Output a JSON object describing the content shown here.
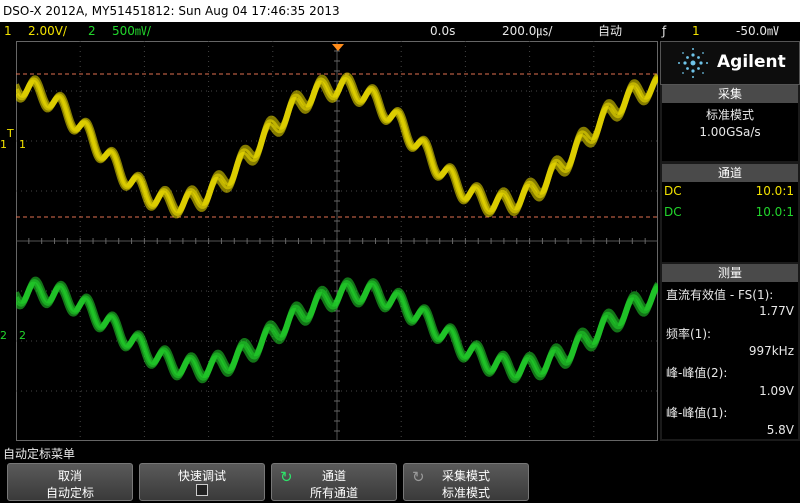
{
  "title_bar": "DSO-X 2012A, MY51451812: Sun Aug 04 17:46:35 2013",
  "status": {
    "ch1_num": "1",
    "ch1_scale": "2.00V/",
    "ch2_num": "2",
    "ch2_scale": "500㎷/",
    "time_delay": "0.0s",
    "time_scale": "200.0㎲/",
    "trigger_mode": "自动",
    "trigger_icon": "ƒ",
    "trigger_source": "1",
    "trigger_level": "-50.0㎷"
  },
  "markers": {
    "trig_letter": "T",
    "ch1_left": "1",
    "ch1_right": "1",
    "ch2_left": "2",
    "ch2_right": "2"
  },
  "panel": {
    "brand": "Agilent",
    "acquire": {
      "header": "采集",
      "mode": "标准模式",
      "rate": "1.00GSa/s"
    },
    "channels": {
      "header": "通道",
      "rows": [
        {
          "coupling": "DC",
          "probe": "10.0:1",
          "color": "#f2e200"
        },
        {
          "coupling": "DC",
          "probe": "10.0:1",
          "color": "#22d62c"
        }
      ]
    },
    "measure": {
      "header": "测量",
      "items": [
        {
          "label": "直流有效值 - FS(1):",
          "value": "1.77V"
        },
        {
          "label": "频率(1):",
          "value": "997kHz"
        },
        {
          "label": "峰-峰值(2):",
          "value": "1.09V"
        },
        {
          "label": "峰-峰值(1):",
          "value": "5.8V"
        }
      ]
    }
  },
  "softkeys": {
    "menu_title": "自动定标菜单",
    "keys": [
      {
        "line1": "取消",
        "line2": "自动定标"
      },
      {
        "line1": "快速调试",
        "line2": ""
      },
      {
        "line1": "通道",
        "line2": "所有通道"
      },
      {
        "line1": "采集模式",
        "line2": "标准模式"
      }
    ]
  },
  "colors": {
    "ch1": "#f2e200",
    "ch2": "#22d62c",
    "trigger": "#ff8c1a"
  }
}
